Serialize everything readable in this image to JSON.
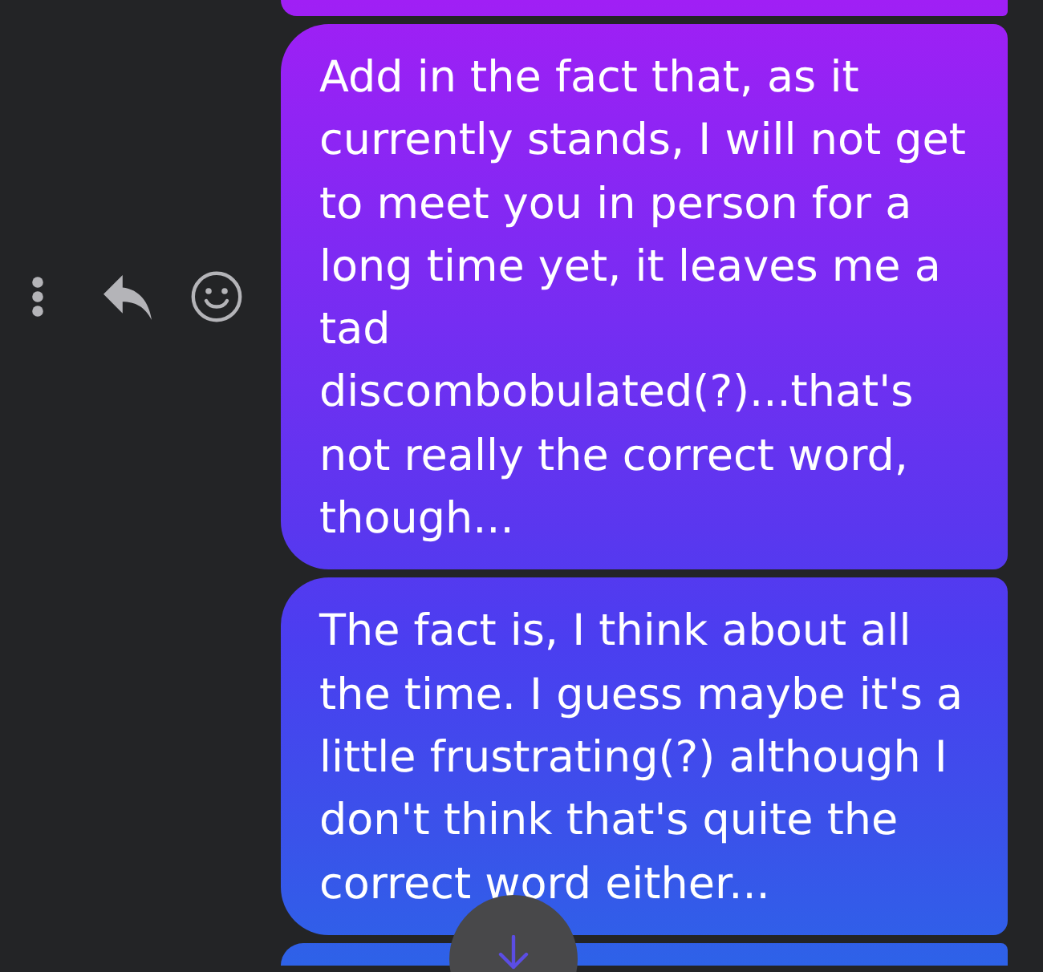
{
  "messages": [
    {
      "kind": "partial"
    },
    {
      "kind": "text",
      "text": "Add in the fact that, as it currently stands, I will not get to meet you in person for a long time yet, it leaves me a tad discombobulated(?)...that's not really the correct word, though...",
      "actions_shown": true
    },
    {
      "kind": "text",
      "text": "The fact is, I think about all the time. I guess maybe it's a little frustrating(?) although I don't think that's quite the correct word either...",
      "actions_shown": false
    },
    {
      "kind": "partial"
    }
  ],
  "scroll_down_button": {
    "shown": true
  }
}
